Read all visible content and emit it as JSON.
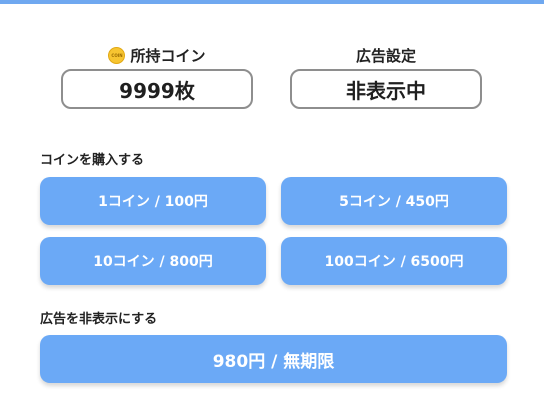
{
  "colors": {
    "accent": "#6ba9f6",
    "top_bar": "#6fa8f0",
    "coin": "#f7c531"
  },
  "status": {
    "coins_label": "所持コイン",
    "coin_icon_text": "COIN",
    "coins_value": "9999枚",
    "ads_label": "広告設定",
    "ads_value": "非表示中"
  },
  "purchase": {
    "title": "コインを購入する",
    "buttons": [
      {
        "label": "1コイン / 100円"
      },
      {
        "label": "5コイン / 450円"
      },
      {
        "label": "10コイン / 800円"
      },
      {
        "label": "100コイン / 6500円"
      }
    ]
  },
  "remove_ads": {
    "title": "広告を非表示にする",
    "button_label": "980円 / 無期限"
  }
}
